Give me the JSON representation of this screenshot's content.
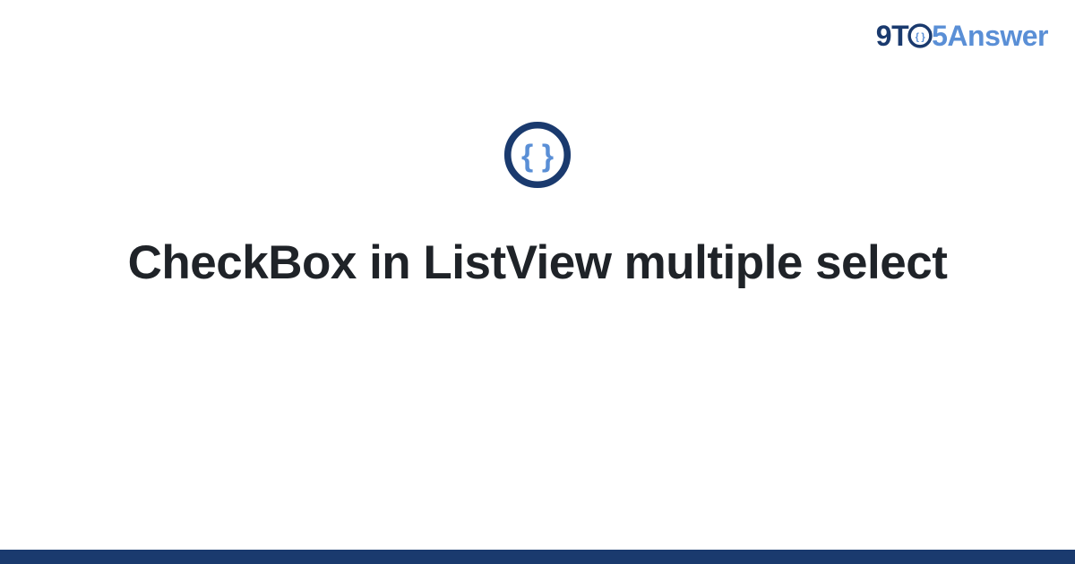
{
  "brand": {
    "part1": "9T",
    "part3": "5Answer"
  },
  "icon_name": "code-braces-icon",
  "title": "CheckBox in ListView multiple select",
  "colors": {
    "brand_dark": "#1a3a6e",
    "brand_light": "#5a8fd6",
    "title_color": "#1f2328",
    "icon_inner": "#5a8fd6",
    "icon_ring": "#1a3a6e",
    "footer_bar": "#1a3a6e"
  }
}
